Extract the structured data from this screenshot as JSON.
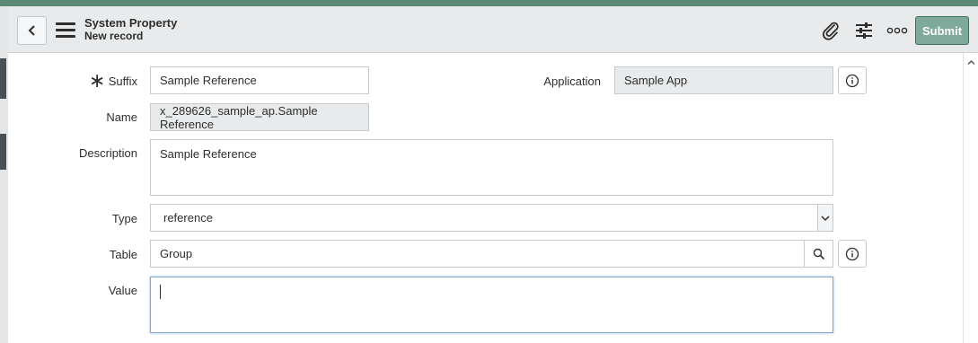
{
  "header": {
    "title": "System Property",
    "subtitle": "New record",
    "submit_label": "Submit"
  },
  "form": {
    "suffix": {
      "label": "Suffix",
      "required_mark": "∗",
      "value": "Sample Reference"
    },
    "application": {
      "label": "Application",
      "value": "Sample App"
    },
    "name": {
      "label": "Name",
      "value": "x_289626_sample_ap.Sample Reference"
    },
    "description": {
      "label": "Description",
      "value": "Sample Reference"
    },
    "type": {
      "label": "Type",
      "value": "reference"
    },
    "table": {
      "label": "Table",
      "value": "Group"
    },
    "value": {
      "label": "Value",
      "value": ""
    }
  },
  "icons": {
    "back": "chevron-left-icon",
    "menu": "hamburger-icon",
    "attachment": "paperclip-icon",
    "settings": "sliders-icon",
    "more": "more-options-icon",
    "info": "info-icon",
    "search": "search-icon",
    "dropdown": "chevron-down-icon",
    "scroll_up": "chevron-up-icon"
  },
  "colors": {
    "accent": "#5a8a74",
    "submit_bg": "#7fa99a",
    "header_bg": "#e8eaeb",
    "readonly_bg": "#e8eaeb"
  }
}
